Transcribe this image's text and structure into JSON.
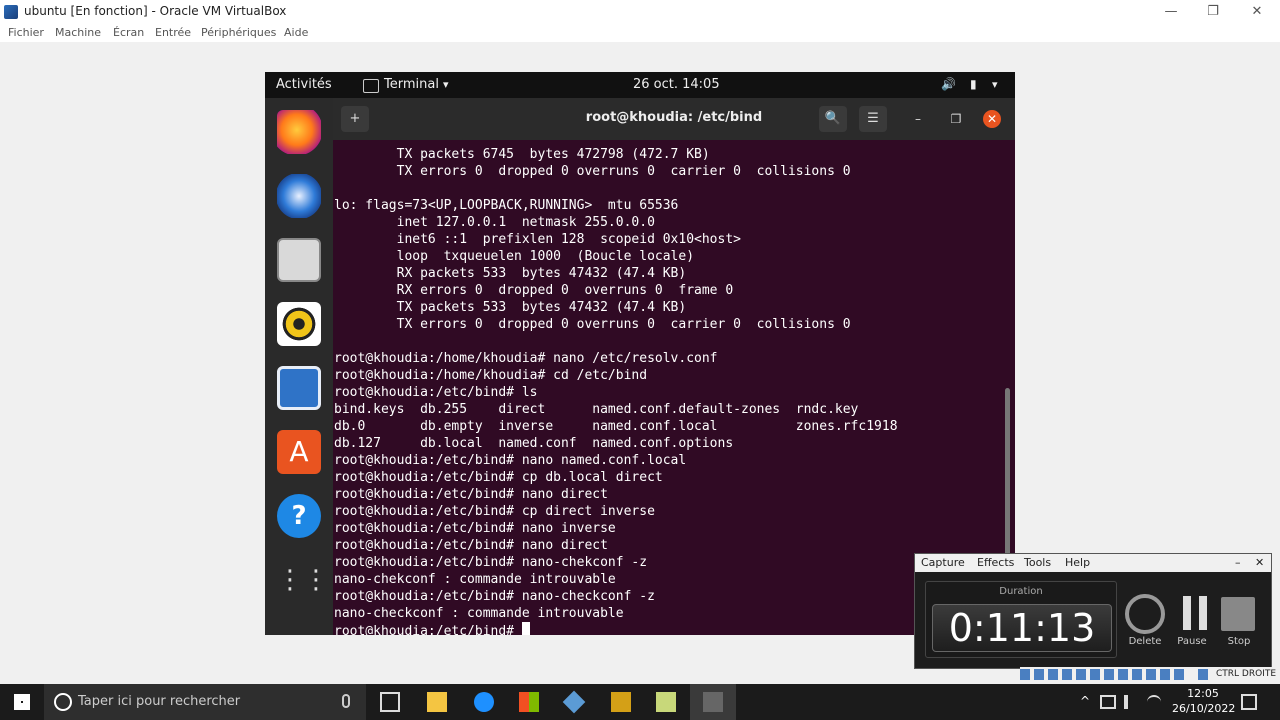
{
  "vbox": {
    "title": "ubuntu [En fonction] - Oracle VM VirtualBox",
    "menu": [
      "Fichier",
      "Machine",
      "Écran",
      "Entrée",
      "Périphériques",
      "Aide"
    ],
    "controls": {
      "minimize": "—",
      "maximize": "❐",
      "close": "✕"
    }
  },
  "guest": {
    "topbar": {
      "activities": "Activités",
      "app_name": "Terminal",
      "app_caret": "▾",
      "clock": "26 oct.  14:05",
      "volume": "🔊",
      "battery": "▮",
      "caret": "▾"
    },
    "dock": [
      "firefox-icon",
      "thunderbird-icon",
      "files-icon",
      "rhythmbox-icon",
      "writer-icon",
      "software-icon",
      "help-icon",
      "apps-grid-icon"
    ],
    "terminal": {
      "title": "root@khoudia: /etc/bind",
      "new_tab": "+",
      "search": "🔍",
      "menu": "☰",
      "minimize": "–",
      "maximize": "❐",
      "close": "✕",
      "lines": [
        "        TX packets 6745  bytes 472798 (472.7 KB)",
        "        TX errors 0  dropped 0 overruns 0  carrier 0  collisions 0",
        "",
        "lo: flags=73<UP,LOOPBACK,RUNNING>  mtu 65536",
        "        inet 127.0.0.1  netmask 255.0.0.0",
        "        inet6 ::1  prefixlen 128  scopeid 0x10<host>",
        "        loop  txqueuelen 1000  (Boucle locale)",
        "        RX packets 533  bytes 47432 (47.4 KB)",
        "        RX errors 0  dropped 0  overruns 0  frame 0",
        "        TX packets 533  bytes 47432 (47.4 KB)",
        "        TX errors 0  dropped 0 overruns 0  carrier 0  collisions 0",
        "",
        "root@khoudia:/home/khoudia# nano /etc/resolv.conf",
        "root@khoudia:/home/khoudia# cd /etc/bind",
        "root@khoudia:/etc/bind# ls",
        "bind.keys  db.255    direct      named.conf.default-zones  rndc.key",
        "db.0       db.empty  inverse     named.conf.local          zones.rfc1918",
        "db.127     db.local  named.conf  named.conf.options",
        "root@khoudia:/etc/bind# nano named.conf.local",
        "root@khoudia:/etc/bind# cp db.local direct",
        "root@khoudia:/etc/bind# nano direct",
        "root@khoudia:/etc/bind# cp direct inverse",
        "root@khoudia:/etc/bind# nano inverse",
        "root@khoudia:/etc/bind# nano direct",
        "root@khoudia:/etc/bind# nano-chekconf -z",
        "nano-chekconf : commande introuvable",
        "root@khoudia:/etc/bind# nano-checkconf -z",
        "nano-checkconf : commande introuvable"
      ],
      "prompt": "root@khoudia:/etc/bind# "
    }
  },
  "recorder": {
    "menu": [
      "Capture",
      "Effects",
      "Tools",
      "Help"
    ],
    "minimize": "–",
    "close": "✕",
    "duration_label": "Duration",
    "duration": "0:11:13",
    "delete_label": "Delete",
    "pause_label": "Pause",
    "stop_label": "Stop"
  },
  "tray_strip": {
    "label": "CTRL DROITE"
  },
  "taskbar": {
    "search_placeholder": "Taper ici pour rechercher",
    "time": "12:05",
    "date": "26/10/2022",
    "chevron": "^"
  }
}
